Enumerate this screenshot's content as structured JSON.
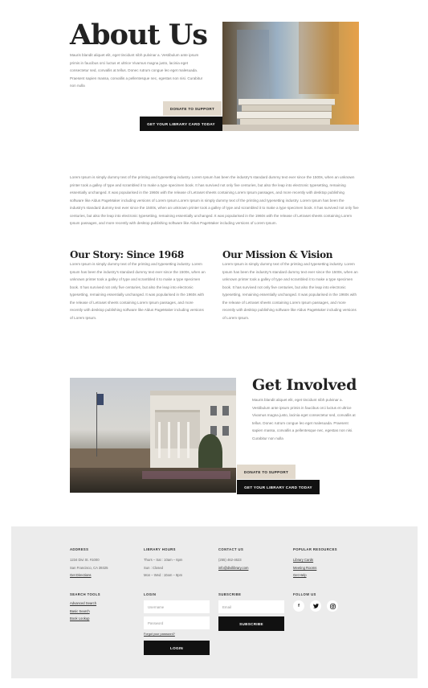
{
  "hero": {
    "title": "About Us",
    "text": "Mauris blandit aliquet elit, eget tincidunt nibh pulvinar a. Vestibulum ante ipsum primis in faucibus orci luctus et ultrice Vivamus magna justo, lacinia eget consectetur sed, convallis at tellus. Donec rutrum congue leo eget malesuada. Praesent sapien massa, convallis a pellentesque nec, egestas non nisi. Curabitur non nulla",
    "donate_label": "DONATE TO SUPPORT",
    "card_label": "GET YOUR LIBRARY CARD TODAY"
  },
  "intro": {
    "text": "Lorem Ipsum is simply dummy text of the printing and typesetting industry. Lorem Ipsum has been the industry's standard dummy text ever since the 1500s, when an unknown printer took a galley of type and scrambled it to make a type specimen book. It has survived not only five centuries, but also the leap into electronic typesetting, remaining essentially unchanged. It was popularised in the 1960s with the release of Letraset sheets containing Lorem Ipsum passages, and more recently with desktop publishing software like Aldus PageMaker including versions of Lorem Ipsum.Lorem Ipsum is simply dummy text of the printing and typesetting industry. Lorem Ipsum has been the industry's standard dummy text ever since the 1500s, when an unknown printer took a galley of type and scrambled it to make a type specimen book. It has survived not only five centuries, but also the leap into electronic typesetting, remaining essentially unchanged. It was popularised in the 1960s with the release of Letraset sheets containing Lorem Ipsum passages, and more recently with desktop publishing software like Aldus PageMaker including versions of Lorem Ipsum."
  },
  "story": {
    "title": "Our Story: Since 1968",
    "text": "Lorem Ipsum is simply dummy text of the printing and typesetting industry. Lorem Ipsum has been the industry's standard dummy text ever since the 1500s, when an unknown printer took a galley of type and scrambled it to make a type specimen book. It has survived not only five centuries, but also the leap into electronic typesetting, remaining essentially unchanged. It was popularised in the 1960s with the release of Letraset sheets containing Lorem Ipsum passages, and more recently with desktop publishing software like Aldus PageMaker including versions of Lorem Ipsum."
  },
  "mission": {
    "title": "Our Mission & Vision",
    "text": "Lorem Ipsum is simply dummy text of the printing and typesetting industry. Lorem Ipsum has been the industry's standard dummy text ever since the 1500s, when an unknown printer took a galley of type and scrambled it to make a type specimen book. It has survived not only five centuries, but also the leap into electronic typesetting, remaining essentially unchanged. It was popularised in the 1960s with the release of Letraset sheets containing Lorem Ipsum passages, and more recently with desktop publishing software like Aldus PageMaker including versions of Lorem Ipsum."
  },
  "involved": {
    "title": "Get Involved",
    "text": "Mauris blandit aliquet elit, eget tincidunt nibh pulvinar a. Vestibulum ante ipsum primis in faucibus orci luctus et ultrice Vivamus magna justo, lacinia eget consectetur sed, convallis at tellus. Donec rutrum congue leo eget malesuada. Praesent sapien massa, convallis a pellentesque nec, egestas non nisi. Curabitur non nulla",
    "donate_label": "DONATE TO SUPPORT",
    "card_label": "GET YOUR LIBRARY CARD TODAY"
  },
  "footer": {
    "address": {
      "heading": "ADDRESS",
      "line1": "1234 Divi St. #1000",
      "line2": "San Francisco, CA 39325",
      "link": "Get Directions"
    },
    "hours": {
      "heading": "LIBRARY HOURS",
      "line1": "Thurs – Sat : 10am – 6pm",
      "line2": "Sun : Closed",
      "line3": "Mon – Wed : 10am – 8pm"
    },
    "contact": {
      "heading": "CONTACT US",
      "phone": "(255) 462-4623",
      "email": "info@divilibrary.com"
    },
    "resources": {
      "heading": "POPULAR RESOURCES",
      "links": [
        "Library Cards",
        "Meeting Rooms",
        "Get Help"
      ]
    },
    "search": {
      "heading": "SEARCH TOOLS",
      "links": [
        "Advanced Search",
        "Basic Search",
        "Book Lookup"
      ]
    },
    "login": {
      "heading": "LOGIN",
      "username_placeholder": "Username",
      "password_placeholder": "Password",
      "forgot": "Forgot your password?",
      "button": "LOGIN"
    },
    "subscribe": {
      "heading": "SUBSCRIBE",
      "email_placeholder": "Email",
      "button": "SUBSCRIBE"
    },
    "follow": {
      "heading": "FOLLOW US",
      "icons": [
        "f",
        "t",
        "ig"
      ]
    }
  }
}
